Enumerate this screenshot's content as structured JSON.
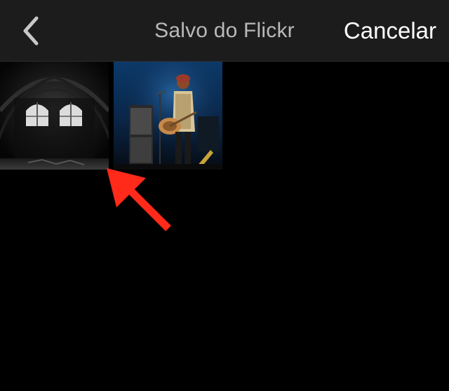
{
  "navbar": {
    "back_icon": "chevron-left-icon",
    "title": "Salvo do Flickr",
    "cancel_label": "Cancelar"
  },
  "photos": [
    {
      "subject": "dark vaulted attic with two arched windows"
    },
    {
      "subject": "musician on stage with amplifiers under blue light"
    }
  ],
  "annotation": {
    "icon": "red-arrow-icon",
    "color": "#ff2a1a"
  },
  "colors": {
    "navbar_bg": "#1c1c1c",
    "background": "#000000",
    "title_text": "#b9b9b9",
    "button_text": "#ffffff"
  }
}
